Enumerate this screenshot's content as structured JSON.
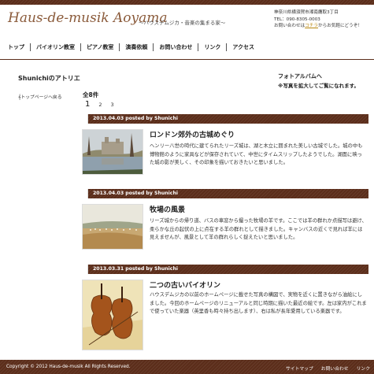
{
  "site": {
    "logo": "Haus-de-musik Aoyama",
    "tagline": "～ハウスデムジカ・音楽の集まる家～",
    "address_line1": "神奈川県横須賀市湘南鷹取3丁目",
    "address_line2": "TEL：090-8305-0003",
    "address_line3_pre": "お問い合わせは",
    "address_line3_link": "コチラ",
    "address_line3_post": "からお気軽にどうぞ！"
  },
  "nav": {
    "items": [
      {
        "label": "トップ"
      },
      {
        "label": "バイオリン教室"
      },
      {
        "label": "ピアノ教室"
      },
      {
        "label": "演奏依頼"
      },
      {
        "label": "お問い合わせ"
      },
      {
        "label": "リンク"
      },
      {
        "label": "アクセス"
      }
    ]
  },
  "page": {
    "title": "Shunichiのアトリエ",
    "back_link": "トップページへ戻る",
    "count": "全8件",
    "pages": [
      "1",
      "2",
      "3"
    ],
    "current_page": "1"
  },
  "sidebar": {
    "photo_title": "フォトアルバムへ",
    "photo_sub": "※写真を拡大してご覧になれます。"
  },
  "posts": [
    {
      "meta": "2013.04.03 posted by Shunichi",
      "title": "ロンドン郊外の古城めぐり",
      "body": "ヘンリー八世の時代に建てられたリーズ城は、湖と木立に囲まれた美しい古城でした。城の中も博物館のように家具などが保存されていて、中世にタイムスリップしたようでした。湖面に映った城の影が美しく、その印象を描いておきたいと思いました。",
      "image": "castle-painting"
    },
    {
      "meta": "2013.04.03 posted by Shunichi",
      "title": "牧場の風景",
      "body": "リーズ城からの帰り道、バスの車窓から撮った牧場の羊です。ここでは羊の群れか点描写は避け、柔らかな丘の起伏の上に点在する羊の群れとして描きました。キャンバスの近くで見れば羊には見えませんが、風景として羊の群れらしく捉えたいと思いました。",
      "image": "pasture-painting"
    },
    {
      "meta": "2013.03.31 posted by Shunichi",
      "title": "二つの古いバイオリン",
      "body": "ハウスデムジカの以前のホームページに載せた写真の構図で、実物を近くに置きながら油絵にしました。今回のホームページのリニューアルと同じ時期に描いた最近の絵です。左は家内がこれまで使っていた楽器（英里香も時々持ち出します）、右は私が長年愛用している楽器です。",
      "image": "violins-painting"
    }
  ],
  "footer": {
    "copyright": "Copyright © 2012 Haus-de-musik All Rights Reserved.",
    "links": [
      "サイトマップ",
      "お問い合わせ",
      "リンク"
    ]
  }
}
